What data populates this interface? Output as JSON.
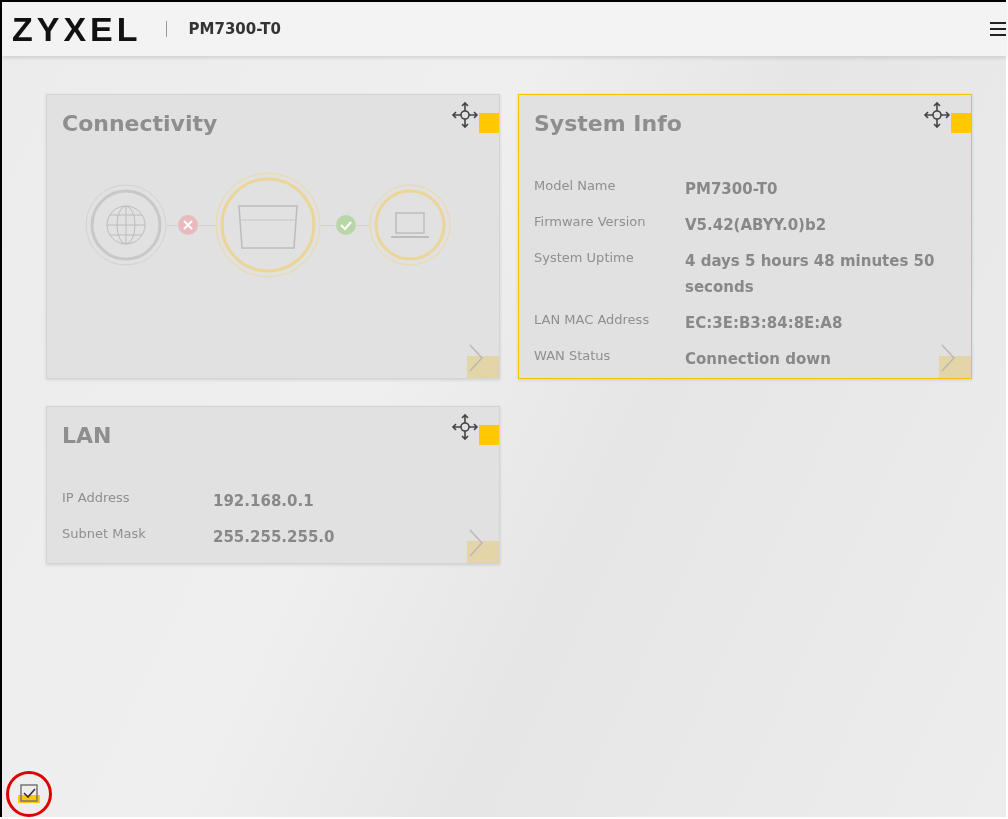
{
  "header": {
    "logo": "ZYXEL",
    "model": "PM7300-T0"
  },
  "widgets": [
    {
      "kind": "connectivity",
      "title": "Connectivity",
      "highlighted": false,
      "wan_link_up": false,
      "lan_link_up": true
    },
    {
      "kind": "info",
      "title": "System Info",
      "highlighted": true,
      "rows": [
        {
          "label": "Model Name",
          "value": "PM7300-T0"
        },
        {
          "label": "Firmware Version",
          "value": "V5.42(ABYY.0)b2"
        },
        {
          "label": "System Uptime",
          "value": "4 days 5 hours 48 minutes 50 seconds"
        },
        {
          "label": "LAN MAC Address",
          "value": "EC:3E:B3:84:8E:A8"
        },
        {
          "label": "WAN Status",
          "value": "Connection down"
        }
      ]
    },
    {
      "kind": "info",
      "title": "LAN",
      "highlighted": false,
      "rows": [
        {
          "label": "IP Address",
          "value": "192.168.0.1"
        },
        {
          "label": "Subnet Mask",
          "value": "255.255.255.0"
        }
      ]
    }
  ],
  "footer": {
    "edit_mode_checked": true,
    "annotated": true
  }
}
